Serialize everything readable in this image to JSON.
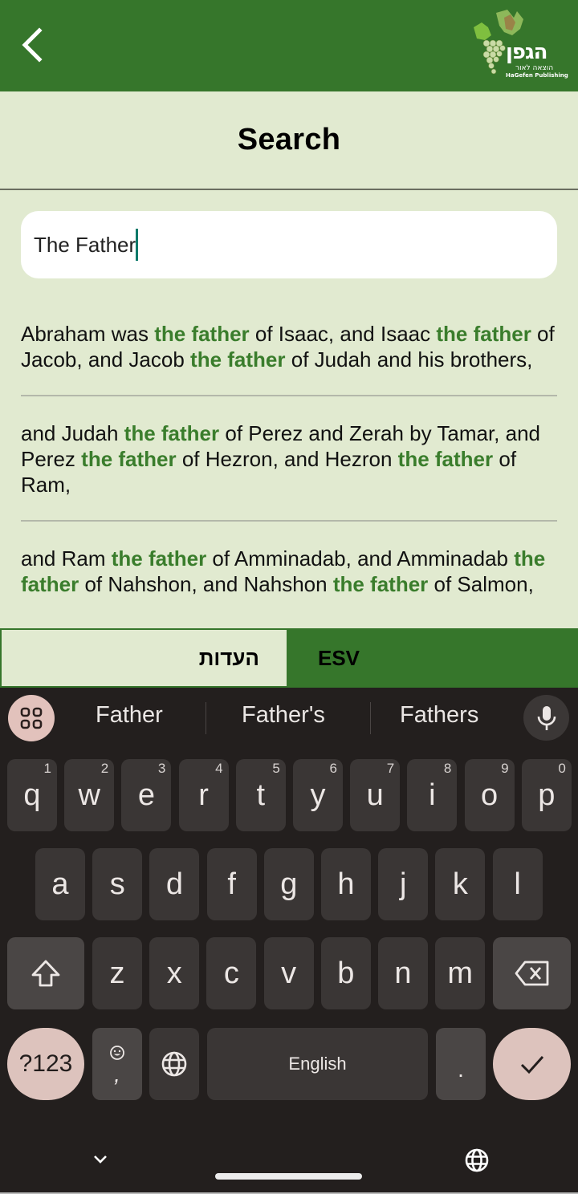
{
  "header": {
    "back_icon": "chevron-left-icon",
    "logo": {
      "hebrew_name": "הגפן",
      "hebrew_sub": "הוצאה לאור",
      "english_name": "HaGefen Publishing",
      "icon": "grape-vine-icon"
    }
  },
  "page_title": "Search",
  "search": {
    "value": "The Father",
    "caret_color": "#0d7a6a"
  },
  "results": [
    {
      "segments": [
        {
          "text": " Abraham was ",
          "hl": false
        },
        {
          "text": "the father",
          "hl": true
        },
        {
          "text": " of Isaac, and Isaac ",
          "hl": false
        },
        {
          "text": "the father",
          "hl": true
        },
        {
          "text": " of Jacob, and Jacob ",
          "hl": false
        },
        {
          "text": "the father",
          "hl": true
        },
        {
          "text": " of Judah and his brothers,",
          "hl": false
        }
      ]
    },
    {
      "segments": [
        {
          "text": " and Judah ",
          "hl": false
        },
        {
          "text": "the father",
          "hl": true
        },
        {
          "text": " of Perez and Zerah by Tamar, and Perez ",
          "hl": false
        },
        {
          "text": "the father",
          "hl": true
        },
        {
          "text": " of Hezron, and Hezron ",
          "hl": false
        },
        {
          "text": "the father",
          "hl": true
        },
        {
          "text": " of Ram,",
          "hl": false
        }
      ]
    },
    {
      "segments": [
        {
          "text": " and Ram ",
          "hl": false
        },
        {
          "text": "the father",
          "hl": true
        },
        {
          "text": " of Amminadab, and Amminadab ",
          "hl": false
        },
        {
          "text": "the father",
          "hl": true
        },
        {
          "text": " of Nahshon, and Nahshon ",
          "hl": false
        },
        {
          "text": "the father",
          "hl": true
        },
        {
          "text": " of Salmon,",
          "hl": false
        }
      ]
    }
  ],
  "tabs": [
    {
      "label": "העדות",
      "active": false
    },
    {
      "label": "ESV",
      "active": true
    }
  ],
  "colors": {
    "brand_green": "#36762b",
    "highlight_green": "#3a7d2c",
    "background": "#e1ead0",
    "keyboard_bg": "#231f1e",
    "keyboard_accent": "#ddc3bd"
  },
  "keyboard": {
    "suggestions": [
      "Father",
      "Father's",
      "Fathers"
    ],
    "apps_icon": "grid-apps-icon",
    "mic_icon": "microphone-icon",
    "row1": [
      {
        "key": "q",
        "hint": "1"
      },
      {
        "key": "w",
        "hint": "2"
      },
      {
        "key": "e",
        "hint": "3"
      },
      {
        "key": "r",
        "hint": "4"
      },
      {
        "key": "t",
        "hint": "5"
      },
      {
        "key": "y",
        "hint": "6"
      },
      {
        "key": "u",
        "hint": "7"
      },
      {
        "key": "i",
        "hint": "8"
      },
      {
        "key": "o",
        "hint": "9"
      },
      {
        "key": "p",
        "hint": "0"
      }
    ],
    "row2": [
      "a",
      "s",
      "d",
      "f",
      "g",
      "h",
      "j",
      "k",
      "l"
    ],
    "row3": [
      "z",
      "x",
      "c",
      "v",
      "b",
      "n",
      "m"
    ],
    "shift_icon": "shift-icon",
    "backspace_icon": "backspace-icon",
    "symbols_label": "?123",
    "emoji_icon": "emoji-icon",
    "comma_label": ",",
    "globe_icon": "globe-icon",
    "space_label": "English",
    "period_label": ".",
    "enter_icon": "checkmark-icon",
    "nav_hide_icon": "chevron-down-icon",
    "nav_lang_icon": "globe-icon"
  }
}
